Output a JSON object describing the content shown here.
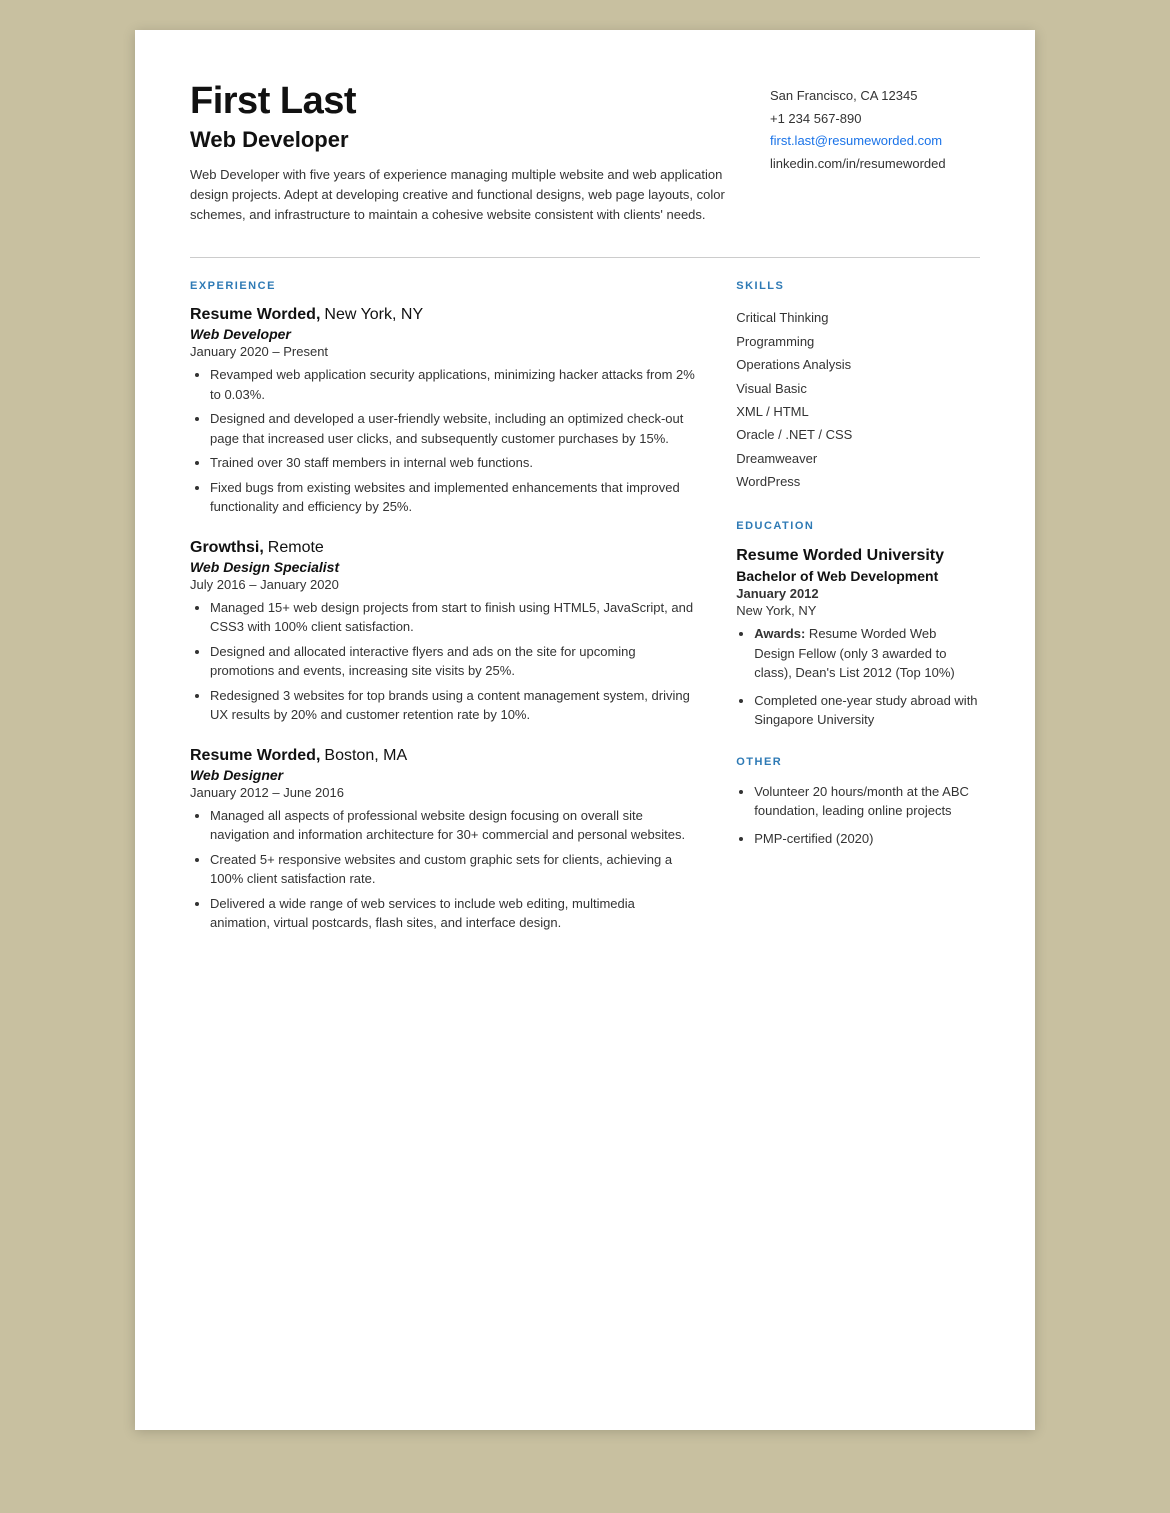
{
  "header": {
    "name": "First Last",
    "title": "Web Developer",
    "summary": "Web Developer with five years of experience managing multiple website and web application design projects. Adept at developing creative and functional designs, web page layouts, color schemes, and infrastructure to maintain a cohesive website consistent with clients' needs.",
    "contact": {
      "address": "San Francisco, CA 12345",
      "phone": "+1 234 567-890",
      "email": "first.last@resumeworded.com",
      "linkedin": "linkedin.com/in/resumeworded"
    }
  },
  "sections": {
    "experience_label": "EXPERIENCE",
    "skills_label": "SKILLS",
    "education_label": "EDUCATION",
    "other_label": "OTHER"
  },
  "experience": [
    {
      "company": "Resume Worded",
      "location": "New York, NY",
      "title": "Web Developer",
      "dates": "January 2020 – Present",
      "bullets": [
        "Revamped web application security applications, minimizing hacker attacks from 2% to 0.03%.",
        "Designed and developed a user-friendly website, including an optimized check-out page that increased user clicks, and subsequently customer purchases by 15%.",
        "Trained over 30 staff members in internal web functions.",
        "Fixed bugs from existing websites and implemented enhancements that improved functionality and efficiency by 25%."
      ]
    },
    {
      "company": "Growthsi",
      "location": "Remote",
      "title": "Web Design Specialist",
      "dates": "July 2016 – January 2020",
      "bullets": [
        "Managed 15+ web design projects from start to finish using HTML5, JavaScript, and CSS3 with 100% client satisfaction.",
        "Designed and allocated interactive flyers and ads on the site for upcoming promotions and events, increasing site visits by 25%.",
        "Redesigned 3 websites for top brands using a content management system, driving UX results by 20% and customer retention rate by 10%."
      ]
    },
    {
      "company": "Resume Worded",
      "location": "Boston, MA",
      "title": "Web Designer",
      "dates": "January 2012 – June 2016",
      "bullets": [
        "Managed all aspects of professional website design focusing on overall site navigation and information architecture for 30+ commercial and personal websites.",
        "Created 5+ responsive websites and custom graphic sets for clients, achieving a 100% client satisfaction rate.",
        "Delivered a wide range of web services to include web editing, multimedia animation, virtual postcards, flash sites, and interface design."
      ]
    }
  ],
  "skills": [
    "Critical Thinking",
    "Programming",
    "Operations Analysis",
    "Visual Basic",
    "XML / HTML",
    "Oracle / .NET / CSS",
    "Dreamweaver",
    "WordPress"
  ],
  "education": {
    "school": "Resume Worded University",
    "degree": "Bachelor of Web Development",
    "date": "January 2012",
    "location": "New York, NY",
    "bullets": [
      {
        "label": "Awards:",
        "text": " Resume Worded Web Design Fellow (only 3 awarded to class), Dean's List 2012 (Top 10%)"
      },
      {
        "label": "",
        "text": "Completed one-year study abroad with Singapore University"
      }
    ]
  },
  "other": [
    "Volunteer 20 hours/month at the ABC foundation, leading online projects",
    "PMP-certified (2020)"
  ]
}
